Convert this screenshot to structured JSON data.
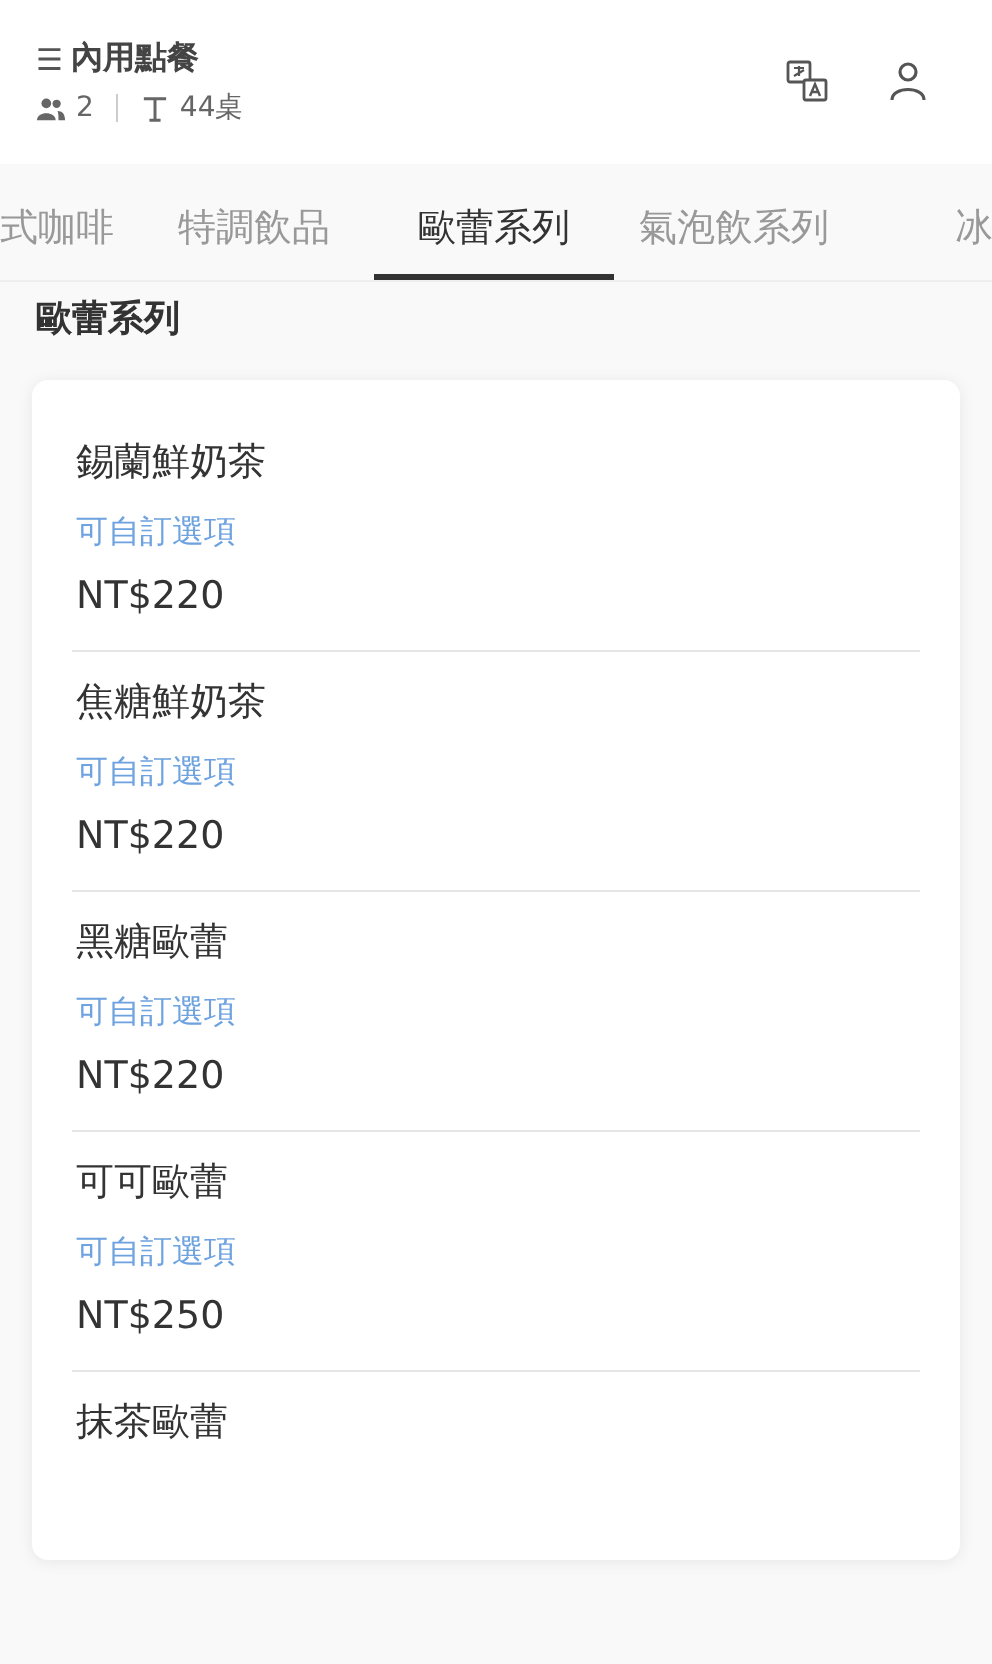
{
  "header": {
    "menu_icon": "☰",
    "title": "內用點餐",
    "guests": "2",
    "table": "44桌"
  },
  "tabs": [
    {
      "label": "式咖啡",
      "selected": false
    },
    {
      "label": "特調飲品",
      "selected": false
    },
    {
      "label": "歐蕾系列",
      "selected": true
    },
    {
      "label": "氣泡飲系列",
      "selected": false
    },
    {
      "label": "冰",
      "selected": false
    }
  ],
  "section_title": "歐蕾系列",
  "items": [
    {
      "name": "錫蘭鮮奶茶",
      "note": "可自訂選項",
      "price": "NT$220"
    },
    {
      "name": "焦糖鮮奶茶",
      "note": "可自訂選項",
      "price": "NT$220"
    },
    {
      "name": "黑糖歐蕾",
      "note": "可自訂選項",
      "price": "NT$220"
    },
    {
      "name": "可可歐蕾",
      "note": "可自訂選項",
      "price": "NT$250"
    },
    {
      "name": "抹茶歐蕾"
    }
  ]
}
